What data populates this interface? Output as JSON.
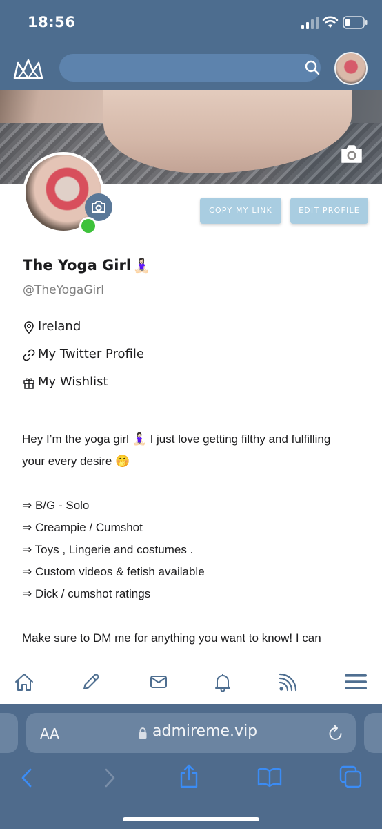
{
  "status_bar": {
    "time": "18:56"
  },
  "header": {
    "search_placeholder": ""
  },
  "profile": {
    "copy_link_label": "COPY MY LINK",
    "edit_profile_label": "EDIT PROFILE",
    "display_name": "The Yoga Girl",
    "name_emoji": "🧘🏻‍♀️",
    "handle": "@TheYogaGirl",
    "location": "Ireland",
    "twitter_link": "My Twitter Profile",
    "wishlist_link": "My Wishlist"
  },
  "bio": {
    "line1": "Hey I’m the yoga girl 🧘🏻‍♀️ I just love getting filthy and fulfilling",
    "line2": "your every desire 🤭",
    "items": [
      "⇒ B/G - Solo",
      "⇒ Creampie / Cumshot",
      "⇒ Toys , Lingerie and costumes .",
      "⇒ Custom videos & fetish available",
      "⇒ Dick / cumshot ratings"
    ],
    "cta": "Make sure to DM me for anything you want to know! I can"
  },
  "browser": {
    "aa_label": "AA",
    "url": "admireme.vip"
  },
  "colors": {
    "header_bg": "#4d6d8f",
    "button_bg": "#a9cde1",
    "online": "#3ec23b",
    "nav_icon": "#4e6e90",
    "safari_accent": "#3b8cf5"
  },
  "icons": {
    "status": [
      "signal-icon",
      "wifi-icon",
      "battery-icon"
    ],
    "nav": [
      "home-icon",
      "pencil-icon",
      "mail-icon",
      "bell-icon",
      "rss-icon",
      "menu-icon"
    ],
    "safari": [
      "back-icon",
      "forward-icon",
      "share-icon",
      "bookmarks-icon",
      "tabs-icon"
    ]
  }
}
